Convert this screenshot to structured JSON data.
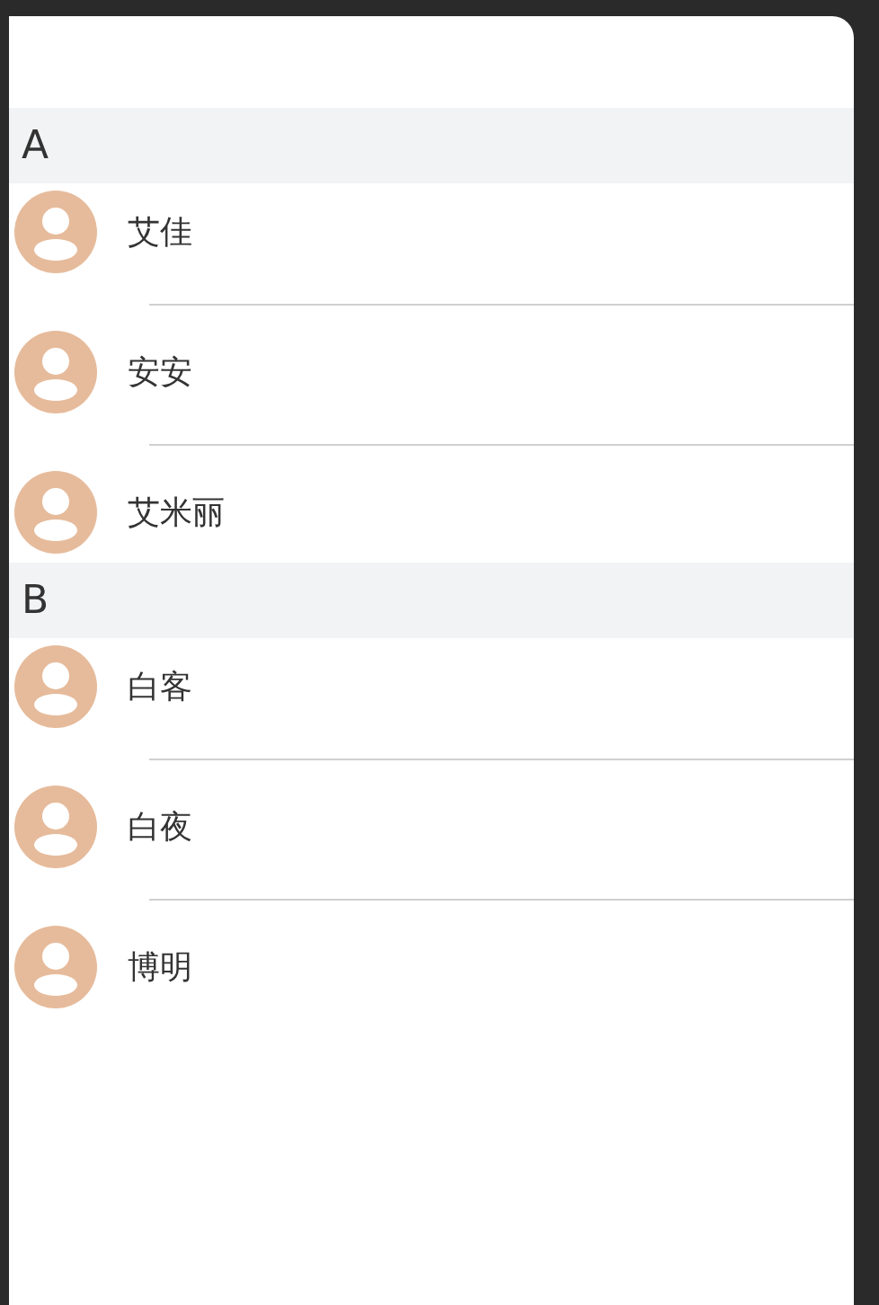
{
  "sections": [
    {
      "letter": "A",
      "contacts": [
        {
          "name": "艾佳"
        },
        {
          "name": "安安"
        },
        {
          "name": "艾米丽"
        }
      ]
    },
    {
      "letter": "B",
      "contacts": [
        {
          "name": "白客"
        },
        {
          "name": "白夜"
        },
        {
          "name": "博明"
        }
      ]
    }
  ]
}
